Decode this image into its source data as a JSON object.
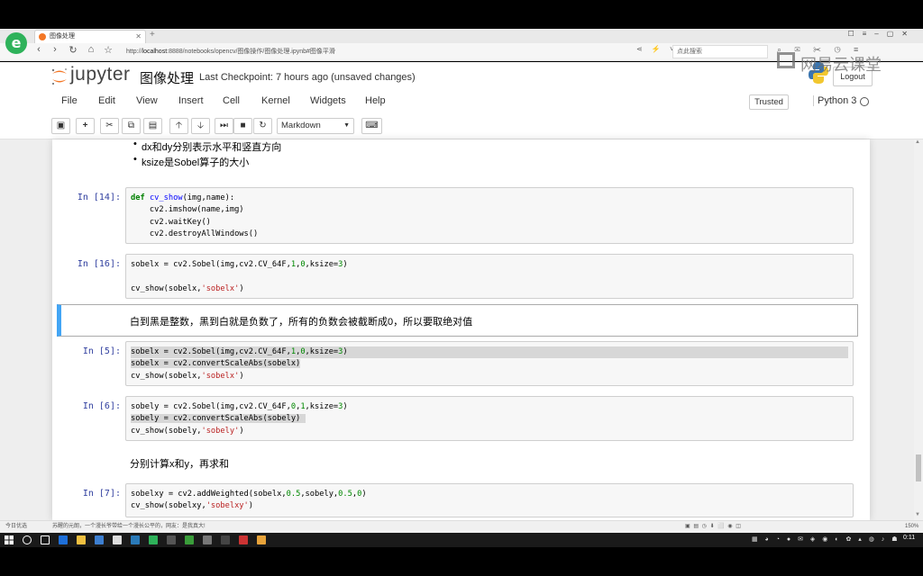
{
  "browser": {
    "tab_title": "图像处理",
    "url_prefix": "http://",
    "url_host": "localhost",
    "url_rest": ":8888/notebooks/opencv/图像操作/图像处理.ipynb#图像平滑",
    "search_placeholder": "点此搜索"
  },
  "watermark": "网易云课堂",
  "header": {
    "logo_text": "jupyter",
    "notebook_name": "图像处理",
    "checkpoint": "Last Checkpoint: 7 hours ago (unsaved changes)",
    "logout_label": "Logout"
  },
  "menu": {
    "items": [
      "File",
      "Edit",
      "View",
      "Insert",
      "Cell",
      "Kernel",
      "Widgets",
      "Help"
    ],
    "trusted": "Trusted",
    "kernel": "Python 3"
  },
  "toolbar": {
    "cell_type": "Markdown"
  },
  "cells": {
    "bullet1": "dx和dy分别表示水平和竖直方向",
    "bullet2": "ksize是Sobel算子的大小",
    "c14": {
      "prompt": "In [14]:",
      "lines": [
        "def cv_show(img,name):",
        "    cv2.imshow(name,img)",
        "    cv2.waitKey()",
        "    cv2.destroyAllWindows()"
      ]
    },
    "c16": {
      "prompt": "In [16]:",
      "lines": [
        "sobelx = cv2.Sobel(img,cv2.CV_64F,1,0,ksize=3)",
        "",
        "cv_show(sobelx,'sobelx')"
      ]
    },
    "md1": "白到黑是整数，黑到白就是负数了，所有的负数会被截断成0，所以要取绝对值",
    "c5": {
      "prompt": "In [5]:",
      "lines": [
        "sobelx = cv2.Sobel(img,cv2.CV_64F,1,0,ksize=3)",
        "sobelx = cv2.convertScaleAbs(sobelx)",
        "cv_show(sobelx,'sobelx')"
      ]
    },
    "c6": {
      "prompt": "In [6]:",
      "lines": [
        "sobely = cv2.Sobel(img,cv2.CV_64F,0,1,ksize=3)",
        "sobely = cv2.convertScaleAbs(sobely)",
        "cv_show(sobely,'sobely')"
      ]
    },
    "md2": "分别计算x和y，再求和",
    "c7": {
      "prompt": "In [7]:",
      "lines": [
        "sobelxy = cv2.addWeighted(sobelx,0.5,sobely,0.5,0)",
        "cv_show(sobelxy,'sobelxy')"
      ]
    }
  },
  "statusbar": {
    "left": "今日优选",
    "news": "苏醒的元朗，一个漫长爷带给一个漫长公平的，网友：是我真大!",
    "zoom": "150%"
  },
  "taskbar": {
    "clock": "0:11"
  },
  "colors": {
    "prompt": "#303f9f",
    "selected_border": "#42a5f5",
    "jupyter_orange": "#f37726"
  }
}
